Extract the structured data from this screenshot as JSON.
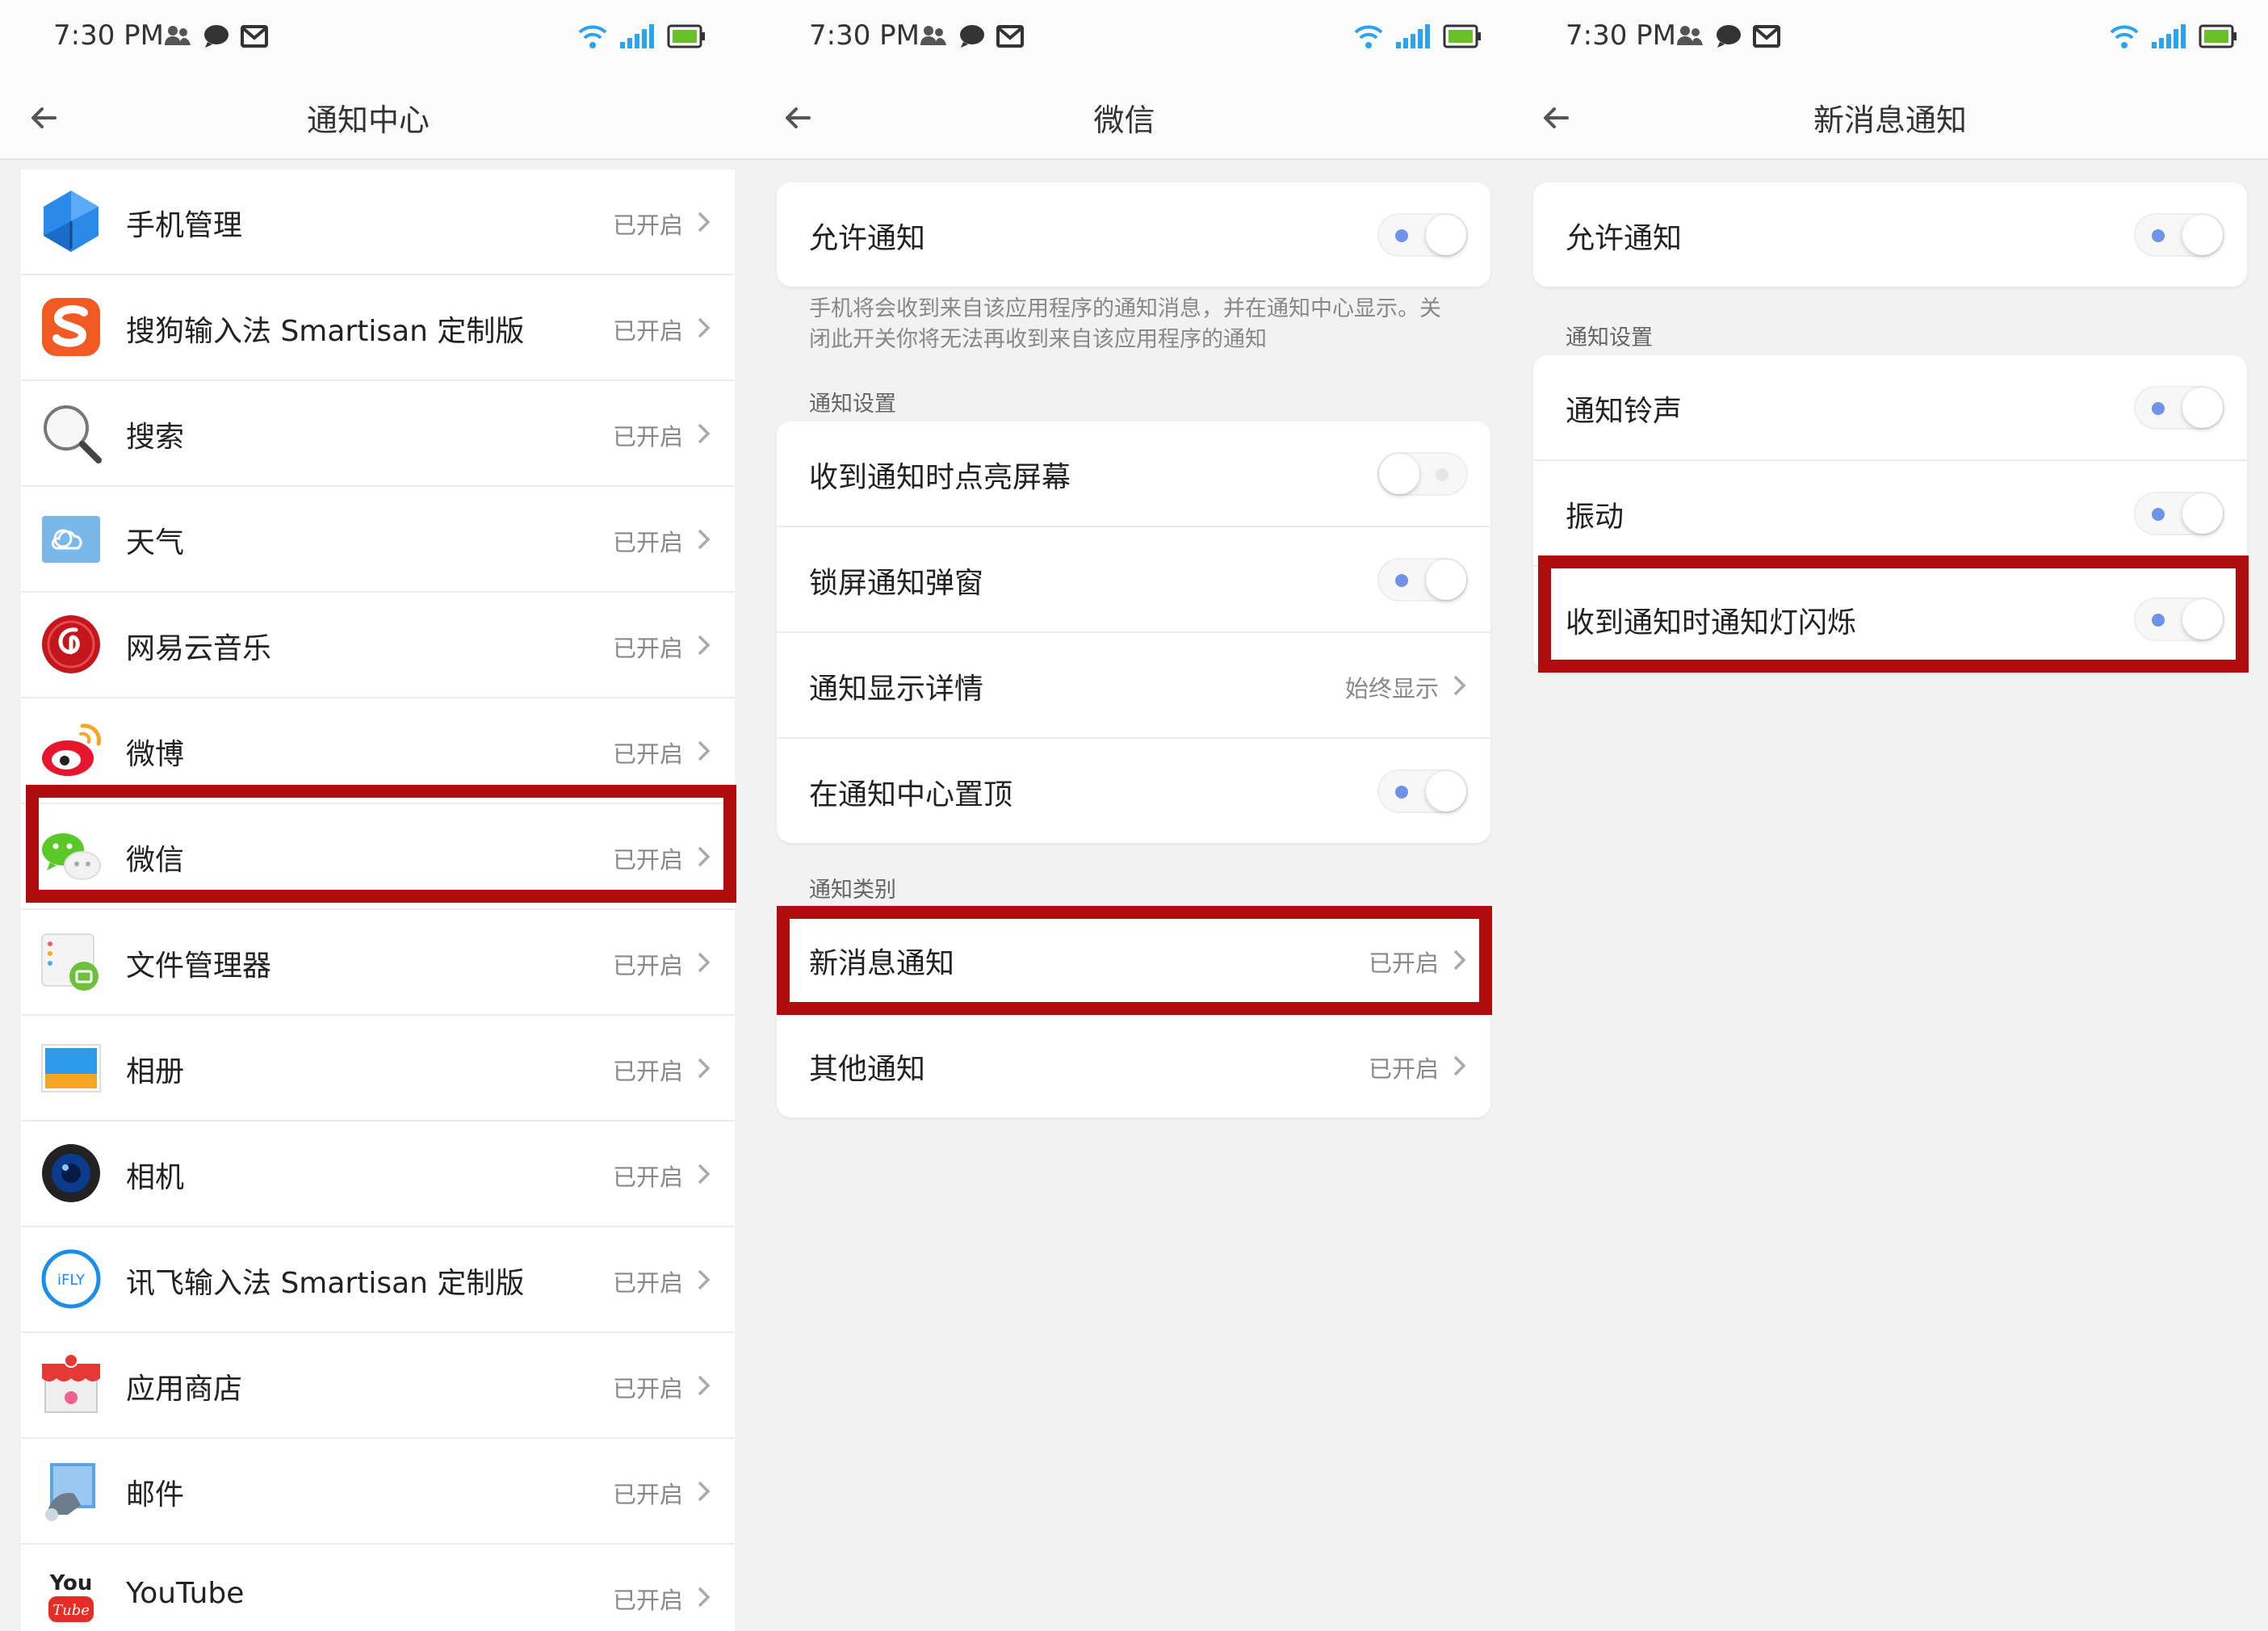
{
  "status_bar": {
    "time": "7:30 PM"
  },
  "panel1": {
    "title": "通知中心",
    "apps": [
      {
        "label": "手机管理",
        "status": "已开启",
        "icon": "umbrella-icon"
      },
      {
        "label": "搜狗输入法 Smartisan 定制版",
        "status": "已开启",
        "icon": "sogou-icon"
      },
      {
        "label": "搜索",
        "status": "已开启",
        "icon": "search-icon"
      },
      {
        "label": "天气",
        "status": "已开启",
        "icon": "weather-icon"
      },
      {
        "label": "网易云音乐",
        "status": "已开启",
        "icon": "netease-music-icon"
      },
      {
        "label": "微博",
        "status": "已开启",
        "icon": "weibo-icon"
      },
      {
        "label": "微信",
        "status": "已开启",
        "icon": "wechat-icon"
      },
      {
        "label": "文件管理器",
        "status": "已开启",
        "icon": "file-manager-icon"
      },
      {
        "label": "相册",
        "status": "已开启",
        "icon": "gallery-icon"
      },
      {
        "label": "相机",
        "status": "已开启",
        "icon": "camera-icon"
      },
      {
        "label": "讯飞输入法 Smartisan 定制版",
        "status": "已开启",
        "icon": "ifly-icon"
      },
      {
        "label": "应用商店",
        "status": "已开启",
        "icon": "app-store-icon"
      },
      {
        "label": "邮件",
        "status": "已开启",
        "icon": "mail-icon"
      },
      {
        "label": "YouTube",
        "status": "已开启",
        "icon": "youtube-icon"
      }
    ],
    "ifly_text": "iFLY",
    "youtube_text_1": "You",
    "youtube_text_2": "Tube"
  },
  "panel2": {
    "title": "微信",
    "allow_label": "允许通知",
    "allow_on": true,
    "description": "手机将会收到来自该应用程序的通知消息，并在通知中心显示。关闭此开关你将无法再收到来自该应用程序的通知",
    "settings_section": "通知设置",
    "settings": [
      {
        "label": "收到通知时点亮屏幕",
        "type": "toggle",
        "on": false
      },
      {
        "label": "锁屏通知弹窗",
        "type": "toggle",
        "on": true
      },
      {
        "label": "通知显示详情",
        "type": "link",
        "status": "始终显示"
      },
      {
        "label": "在通知中心置顶",
        "type": "toggle",
        "on": true
      }
    ],
    "category_section": "通知类别",
    "categories": [
      {
        "label": "新消息通知",
        "status": "已开启"
      },
      {
        "label": "其他通知",
        "status": "已开启"
      }
    ]
  },
  "panel3": {
    "title": "新消息通知",
    "allow_label": "允许通知",
    "allow_on": true,
    "settings_section": "通知设置",
    "settings": [
      {
        "label": "通知铃声",
        "on": true
      },
      {
        "label": "振动",
        "on": true
      },
      {
        "label": "收到通知时通知灯闪烁",
        "on": true
      }
    ]
  },
  "colors": {
    "highlight": "#b00e0e",
    "toggle_dot": "#6e93e9",
    "wifi": "#2aa4ef",
    "battery": "#6ac02a"
  }
}
